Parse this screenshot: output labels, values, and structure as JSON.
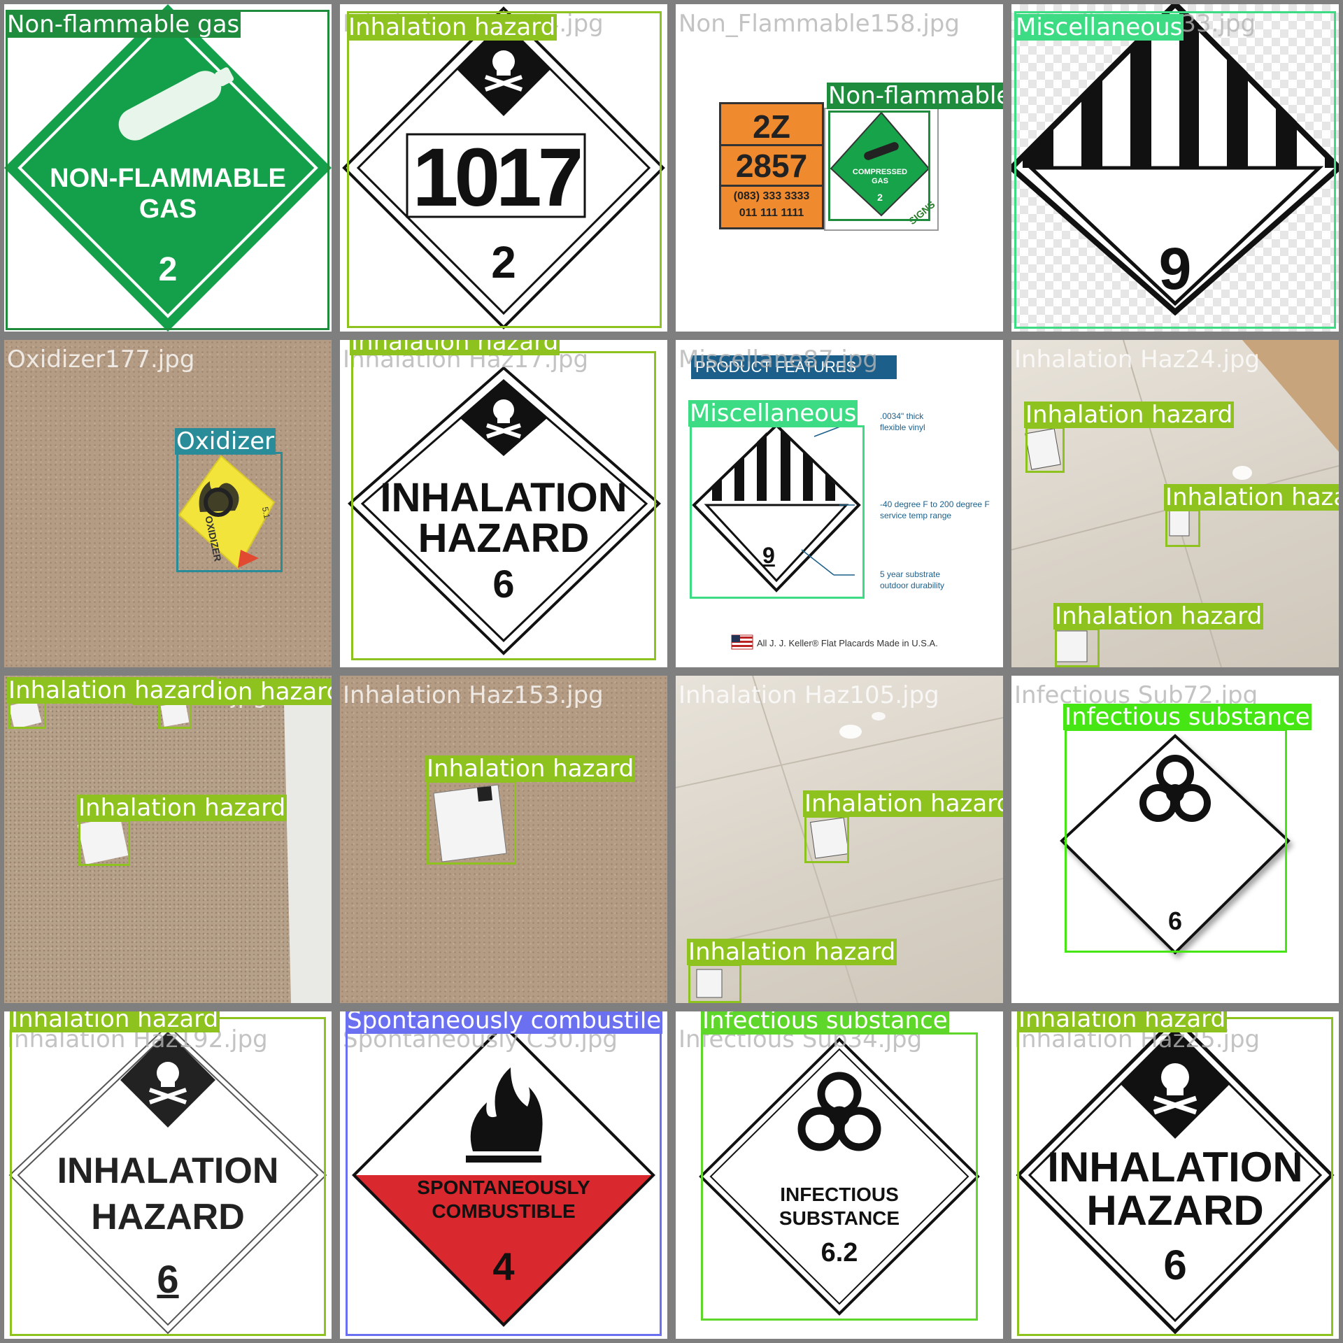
{
  "colors": {
    "inhalation": "#8dc21f",
    "nonflammable": "#1e8c3c",
    "misc": "#3ddc84",
    "oxidizer": "#2a8c99",
    "infectious": "#46e614",
    "spontaneous": "#6b70f0",
    "infectious_lime": "#5fd62a"
  },
  "tiles": {
    "t1": {
      "filename": "Non_Flammable134.jpg",
      "labels": [
        "Non-flammable gas"
      ],
      "placard": [
        "NON-FLAMMABLE",
        "GAS",
        "2"
      ]
    },
    "t2": {
      "filename": "Inhalation Haz124.jpg",
      "labels": [
        "Inhalation hazard"
      ],
      "placard": [
        "1017",
        "2"
      ]
    },
    "t3": {
      "filename": "Non_Flammable158.jpg",
      "labels": [
        "Non-flammable gas"
      ],
      "placard": [
        "2Z",
        "2857",
        "(083) 333 3333",
        "011 111 1111",
        "COMPRESSED",
        "GAS",
        "2",
        "SIGNS"
      ]
    },
    "t4": {
      "filename": "Miscellaneous33.jpg",
      "labels": [
        "Miscellaneous"
      ],
      "placard": [
        "9"
      ]
    },
    "t5": {
      "filename": "Oxidizer177.jpg",
      "labels": [
        "Oxidizer"
      ],
      "placard": [
        "OXIDIZER",
        "5.1"
      ]
    },
    "t6": {
      "filename": "Inhalation Haz17.jpg",
      "labels": [
        "Inhalation hazard"
      ],
      "placard": [
        "INHALATION",
        "HAZARD",
        "6"
      ]
    },
    "t7": {
      "filename": "Miscellane87.jpg",
      "labels": [
        "Miscellaneous"
      ],
      "banner": "PRODUCT FEATURES",
      "notes": [
        ".0034\" thick",
        "flexible vinyl",
        "-40 degree F to 200 degree F",
        "service temp range",
        "5 year substrate",
        "outdoor durability"
      ],
      "footer": "All J. J. Keller® Flat Placards Made in U.S.A.",
      "placard": [
        "9"
      ]
    },
    "t8": {
      "filename": "Inhalation Haz24.jpg",
      "labels": [
        "Inhalation hazard",
        "Inhalation haza",
        "Inhalation hazard"
      ]
    },
    "t9": {
      "filename": "Inhalation Haz111.jpg",
      "labels": [
        "Inhalation hazard",
        "Inhalation hazard",
        "Inhalation hazard"
      ]
    },
    "t10": {
      "filename": "Inhalation Haz153.jpg",
      "labels": [
        "Inhalation hazard"
      ]
    },
    "t11": {
      "filename": "Inhalation Haz105.jpg",
      "labels": [
        "Inhalation hazard",
        "Inhalation hazard"
      ]
    },
    "t12": {
      "filename": "Infectious Sub72.jpg",
      "labels": [
        "Infectious substance"
      ],
      "placard": [
        "6"
      ]
    },
    "t13": {
      "filename": "Inhalation Haz192.jpg",
      "labels": [
        "Inhalation hazard"
      ],
      "placard": [
        "INHALATION",
        "HAZARD",
        "6"
      ]
    },
    "t14": {
      "filename": "Spontaneously C30.jpg",
      "labels": [
        "Spontaneously combustile"
      ],
      "placard": [
        "SPONTANEOUSLY",
        "COMBUSTIBLE",
        "4"
      ]
    },
    "t15": {
      "filename": "Infectious Sub34.jpg",
      "labels": [
        "Infectious substance"
      ],
      "placard": [
        "INFECTIOUS",
        "SUBSTANCE",
        "6.2"
      ]
    },
    "t16": {
      "filename": "Inhalation Haz25.jpg",
      "labels": [
        "Inhalation hazard"
      ],
      "placard": [
        "INHALATION",
        "HAZARD",
        "6"
      ]
    }
  }
}
